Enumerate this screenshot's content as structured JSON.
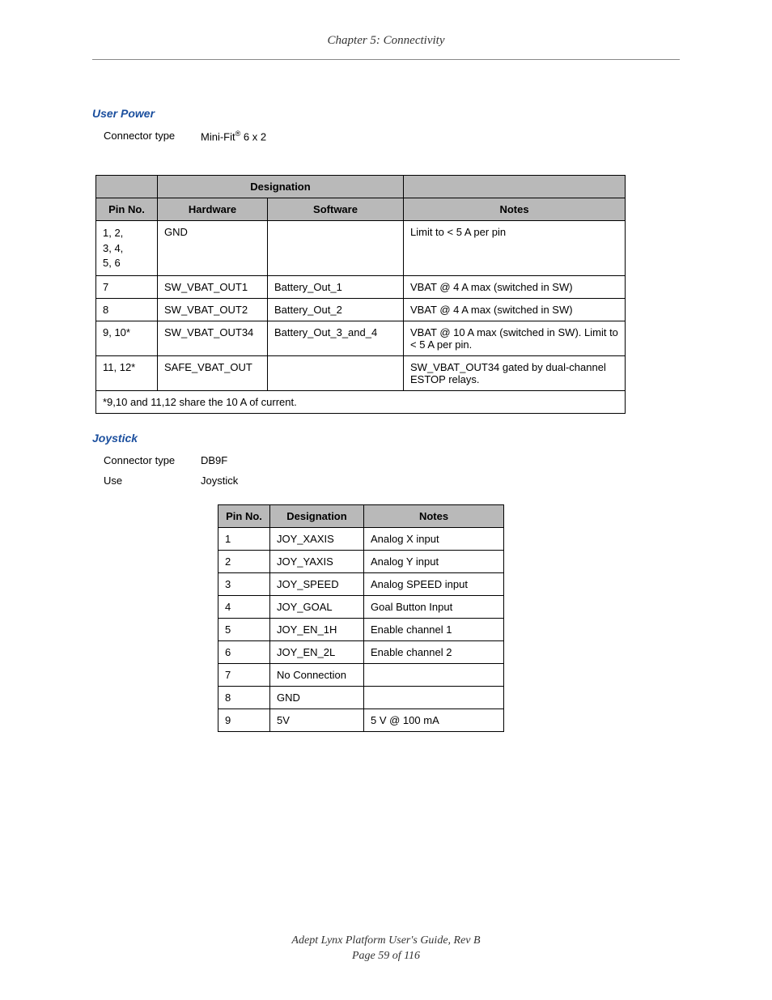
{
  "header": {
    "chapter": "Chapter 5: Connectivity"
  },
  "sections": {
    "user_power": {
      "heading": "User Power",
      "connector_label": "Connector type",
      "connector_value_prefix": "Mini-Fit",
      "connector_value_suffix": " 6 x 2",
      "connector_superscript": "®",
      "table": {
        "header_row1_span": "Designation",
        "header_pin": "Pin No.",
        "header_hw": "Hardware",
        "header_sw": "Software",
        "header_notes": "Notes",
        "rows": [
          {
            "pin": "1, 2,\n3, 4,\n5, 6",
            "hw": "GND",
            "sw": "",
            "notes": "Limit to < 5 A per pin"
          },
          {
            "pin": "7",
            "hw": "SW_VBAT_OUT1",
            "sw": "Battery_Out_1",
            "notes": "VBAT @ 4 A max (switched in SW)"
          },
          {
            "pin": "8",
            "hw": "SW_VBAT_OUT2",
            "sw": "Battery_Out_2",
            "notes": "VBAT @ 4 A max (switched in SW)"
          },
          {
            "pin": "9, 10*",
            "hw": "SW_VBAT_OUT34",
            "sw": "Battery_Out_3_and_4",
            "notes": "VBAT @ 10 A max (switched in SW). Limit to < 5 A per pin."
          },
          {
            "pin": "11, 12*",
            "hw": "SAFE_VBAT_OUT",
            "sw": "",
            "notes": "SW_VBAT_OUT34 gated by dual-channel ESTOP relays."
          }
        ],
        "footnote": "*9,10 and 11,12 share the 10 A of current."
      }
    },
    "joystick": {
      "heading": "Joystick",
      "connector_label": "Connector type",
      "connector_value": "DB9F",
      "use_label": "Use",
      "use_value": "Joystick",
      "table": {
        "header_pin": "Pin No.",
        "header_desig": "Designation",
        "header_notes": "Notes",
        "rows": [
          {
            "pin": "1",
            "desig": "JOY_XAXIS",
            "notes": "Analog X input"
          },
          {
            "pin": "2",
            "desig": "JOY_YAXIS",
            "notes": "Analog Y input"
          },
          {
            "pin": "3",
            "desig": "JOY_SPEED",
            "notes": "Analog SPEED input"
          },
          {
            "pin": "4",
            "desig": "JOY_GOAL",
            "notes": "Goal Button Input"
          },
          {
            "pin": "5",
            "desig": "JOY_EN_1H",
            "notes": "Enable channel 1"
          },
          {
            "pin": "6",
            "desig": "JOY_EN_2L",
            "notes": "Enable channel 2"
          },
          {
            "pin": "7",
            "desig": "No Connection",
            "notes": ""
          },
          {
            "pin": "8",
            "desig": "GND",
            "notes": ""
          },
          {
            "pin": "9",
            "desig": "5V",
            "notes": "5 V @ 100 mA"
          }
        ]
      }
    }
  },
  "footer": {
    "doc_title": "Adept Lynx Platform User's Guide, Rev B",
    "page_line": "Page 59 of 116"
  }
}
